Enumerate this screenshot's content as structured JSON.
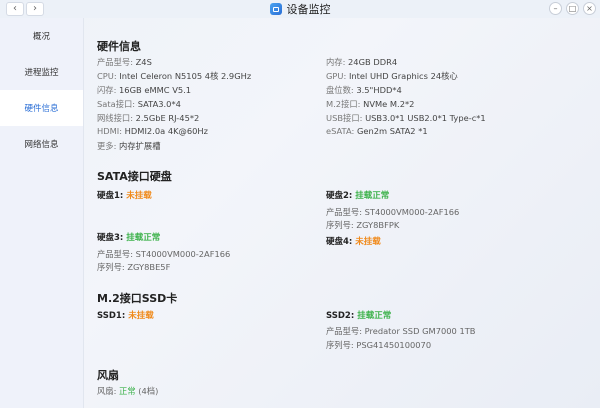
{
  "window": {
    "title": "设备监控",
    "back_label": "‹",
    "forward_label": "›",
    "minimize_label": "–",
    "maximize_label": "□",
    "close_label": "×"
  },
  "sidebar": {
    "items": [
      {
        "label": "概况"
      },
      {
        "label": "进程监控"
      },
      {
        "label": "硬件信息"
      },
      {
        "label": "网络信息"
      }
    ],
    "active": "硬件信息"
  },
  "hardware": {
    "title": "硬件信息",
    "left": [
      {
        "label": "产品型号:",
        "value": "Z4S"
      },
      {
        "label": "CPU:",
        "value": "Intel Celeron N5105 4核 2.9GHz"
      },
      {
        "label": "闪存:",
        "value": "16GB eMMC V5.1"
      },
      {
        "label": "Sata接口:",
        "value": "SATA3.0*4"
      },
      {
        "label": "网线接口:",
        "value": "2.5GbE RJ-45*2"
      },
      {
        "label": "HDMI:",
        "value": "HDMI2.0a 4K@60Hz"
      },
      {
        "label": "更多:",
        "value": "内存扩展槽"
      }
    ],
    "right": [
      {
        "label": "内存:",
        "value": "24GB DDR4"
      },
      {
        "label": "GPU:",
        "value": "Intel UHD Graphics 24核心"
      },
      {
        "label": "盘位数:",
        "value": "3.5\"HDD*4"
      },
      {
        "label": "M.2接口:",
        "value": "NVMe M.2*2"
      },
      {
        "label": "USB接口:",
        "value": "USB3.0*1 USB2.0*1 Type-c*1"
      },
      {
        "label": "eSATA:",
        "value": "Gen2m SATA2 *1"
      }
    ]
  },
  "sata": {
    "title": "SATA接口硬盘",
    "disk1": {
      "label": "硬盘1:",
      "status": "未挂载"
    },
    "disk2": {
      "label": "硬盘2:",
      "status": "挂载正常",
      "model_label": "产品型号:",
      "model": "ST4000VM000-2AF166",
      "serial_label": "序列号:",
      "serial": "ZGY8BFPK"
    },
    "disk3": {
      "label": "硬盘3:",
      "status": "挂载正常",
      "model_label": "产品型号:",
      "model": "ST4000VM000-2AF166",
      "serial_label": "序列号:",
      "serial": "ZGY8BE5F"
    },
    "disk4": {
      "label": "硬盘4:",
      "status": "未挂载"
    }
  },
  "m2": {
    "title": "M.2接口SSD卡",
    "ssd1": {
      "label": "SSD1:",
      "status": "未挂载"
    },
    "ssd2": {
      "label": "SSD2:",
      "status": "挂载正常",
      "model_label": "产品型号:",
      "model": "Predator SSD GM7000 1TB",
      "serial_label": "序列号:",
      "serial": "PSG41450100070"
    }
  },
  "fan": {
    "title": "风扇",
    "label": "风扇:",
    "status": "正常",
    "level": "(4档)"
  },
  "colors": {
    "accent": "#2b6fd6",
    "status_unmounted": "#f08a1b",
    "status_ok": "#3cb24a"
  }
}
